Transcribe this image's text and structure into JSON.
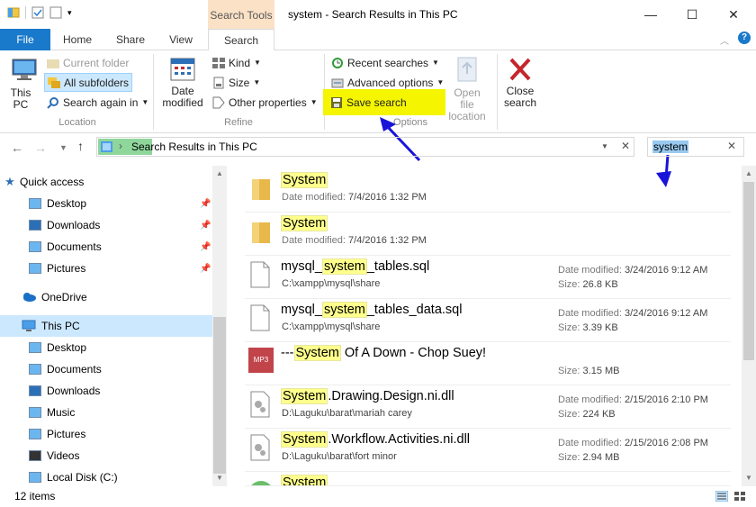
{
  "window": {
    "title": "system - Search Results in This PC",
    "context_tab": "Search Tools",
    "minimize_glyph": "—",
    "maximize_glyph": "☐",
    "close_glyph": "✕"
  },
  "ribbon_tabs": {
    "file": "File",
    "home": "Home",
    "share": "Share",
    "view": "View",
    "search": "Search"
  },
  "ribbon": {
    "location": {
      "this_pc": "This PC",
      "current_folder": "Current folder",
      "all_subfolders": "All subfolders",
      "search_again_in": "Search again in",
      "label": "Location"
    },
    "refine": {
      "date_modified": "Date modified",
      "kind": "Kind",
      "size": "Size",
      "other_properties": "Other properties",
      "label": "Refine"
    },
    "options": {
      "recent_searches": "Recent searches",
      "advanced_options": "Advanced options",
      "save_search": "Save search",
      "open_file_location": "Open file location",
      "label": "Options"
    },
    "close": {
      "close_search": "Close search"
    },
    "highlight_color": "#f5f500",
    "annotation_color": "#1a14d8"
  },
  "address": {
    "path": "Search Results in This PC",
    "search_value": "system"
  },
  "nav": {
    "quick_access": "Quick access",
    "qa_items": [
      "Desktop",
      "Downloads",
      "Documents",
      "Pictures"
    ],
    "onedrive": "OneDrive",
    "this_pc": "This PC",
    "pc_items": [
      "Desktop",
      "Documents",
      "Downloads",
      "Music",
      "Pictures",
      "Videos",
      "Local Disk (C:)"
    ]
  },
  "results": [
    {
      "pre": "",
      "hl": "System",
      "post": "",
      "sub_label": "Date modified:",
      "sub_value": "7/4/2016 1:32 PM",
      "icon": "folder-icon"
    },
    {
      "pre": "",
      "hl": "System",
      "post": "",
      "sub_label": "Date modified:",
      "sub_value": "7/4/2016 1:32 PM",
      "icon": "folder-icon"
    },
    {
      "pre": "mysql_",
      "hl": "system",
      "post": "_tables.sql",
      "path": "C:\\xampp\\mysql\\share",
      "date": "3/24/2016 9:12 AM",
      "size": "26.8 KB",
      "icon": "document-icon"
    },
    {
      "pre": "mysql_",
      "hl": "system",
      "post": "_tables_data.sql",
      "path": "C:\\xampp\\mysql\\share",
      "date": "3/24/2016 9:12 AM",
      "size": "3.39 KB",
      "icon": "document-icon"
    },
    {
      "pre": "---",
      "hl": "System",
      "post": " Of A Down - Chop Suey!",
      "path": "",
      "date": "",
      "size": "3.15 MB",
      "icon": "mp3-icon",
      "badge": "MP3"
    },
    {
      "pre": "",
      "hl": "System",
      "post": ".Drawing.Design.ni.dll",
      "path": "D:\\Laguku\\barat\\mariah carey",
      "date": "2/15/2016 2:10 PM",
      "size": "224 KB",
      "icon": "dll-icon"
    },
    {
      "pre": "",
      "hl": "System",
      "post": ".Workflow.Activities.ni.dll",
      "path": "D:\\Laguku\\barat\\fort minor",
      "date": "2/15/2016 2:08 PM",
      "size": "2.94 MB",
      "icon": "dll-icon"
    },
    {
      "pre": "",
      "hl": "System",
      "post": "",
      "path": "",
      "date": "",
      "size": "",
      "icon": "partial-icon"
    }
  ],
  "labels": {
    "date_modified": "Date modified:",
    "size": "Size:"
  },
  "status": {
    "count": "12 items"
  }
}
